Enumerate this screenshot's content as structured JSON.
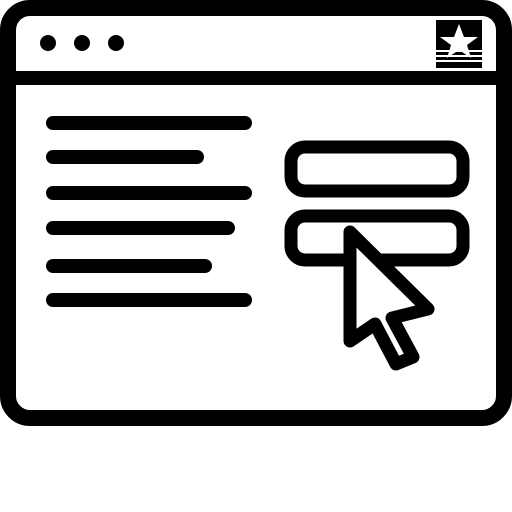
{
  "window": {
    "controls": [
      "window-dot-1",
      "window-dot-2",
      "window-dot-3"
    ],
    "title_bar_logo": "star-logo-icon"
  },
  "content": {
    "text_lines": 6,
    "input_fields": [
      "input-field-1",
      "input-field-2"
    ],
    "pointer_icon": "mouse-cursor-icon"
  },
  "colors": {
    "stroke": "#000000",
    "background": "#ffffff"
  }
}
